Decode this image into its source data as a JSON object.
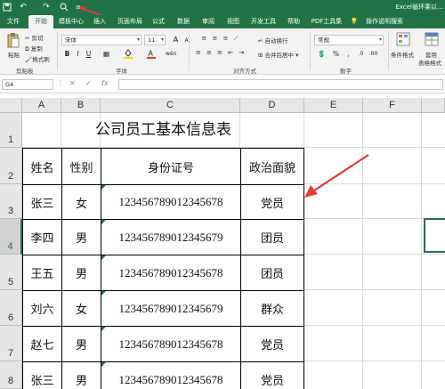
{
  "window": {
    "title": "Excel循环乘以…",
    "quick_access": {
      "save_icon": "save-icon",
      "undo_icon": "undo-icon",
      "redo_icon": "redo-icon",
      "preview_icon": "print-preview-icon",
      "customize_icon": "customize-quick-access-icon"
    }
  },
  "tabs": [
    "文件",
    "开始",
    "模板中心",
    "插入",
    "页面布局",
    "公式",
    "数据",
    "审阅",
    "视图",
    "开发工具",
    "帮助",
    "PDF工具集",
    "操作说明搜索"
  ],
  "ribbon": {
    "clipboard": {
      "paste": "粘贴",
      "cut": "剪切",
      "copy": "复制",
      "format_painter": "格式刷",
      "label": "剪贴板"
    },
    "font": {
      "name": "宋体",
      "size": "11",
      "bold": "B",
      "italic": "I",
      "underline": "U",
      "grow": "A",
      "shrink": "A",
      "phonetic": "wén",
      "label": "字体"
    },
    "alignment": {
      "wrap": "自动换行",
      "merge": "合并后居中",
      "label": "对齐方式"
    },
    "number": {
      "format": "常规",
      "percent": "%",
      "comma": ",",
      "label": "数字"
    },
    "styles": {
      "conditional": "条件格式",
      "table_format_1": "套用",
      "table_format_2": "表格格式"
    },
    "colors": {
      "tab_bar": "#217346",
      "font_color": "#e03b24",
      "fill_color": "#ffd700"
    }
  },
  "formula_bar": {
    "name_box": "G4",
    "cancel": "✕",
    "enter": "✓",
    "fx": "fx",
    "value": ""
  },
  "columns": [
    "A",
    "B",
    "C",
    "D",
    "E",
    "F"
  ],
  "rows": [
    "1",
    "2",
    "3",
    "4",
    "5",
    "6",
    "7",
    "8"
  ],
  "selected_row": "4",
  "sheet": {
    "title": "公司员工基本信息表",
    "headers": [
      "姓名",
      "性别",
      "身份证号",
      "政治面貌"
    ],
    "records": [
      [
        "张三",
        "女",
        "123456789012345678",
        "党员"
      ],
      [
        "李四",
        "男",
        "123456789012345679",
        "团员"
      ],
      [
        "王五",
        "男",
        "123456789012345678",
        "团员"
      ],
      [
        "刘六",
        "女",
        "123456789012345679",
        "群众"
      ],
      [
        "赵七",
        "男",
        "123456789012345678",
        "党员"
      ],
      [
        "张三",
        "男",
        "123456789012345678",
        "党员"
      ]
    ]
  },
  "annotation_color": "#e03b3b"
}
